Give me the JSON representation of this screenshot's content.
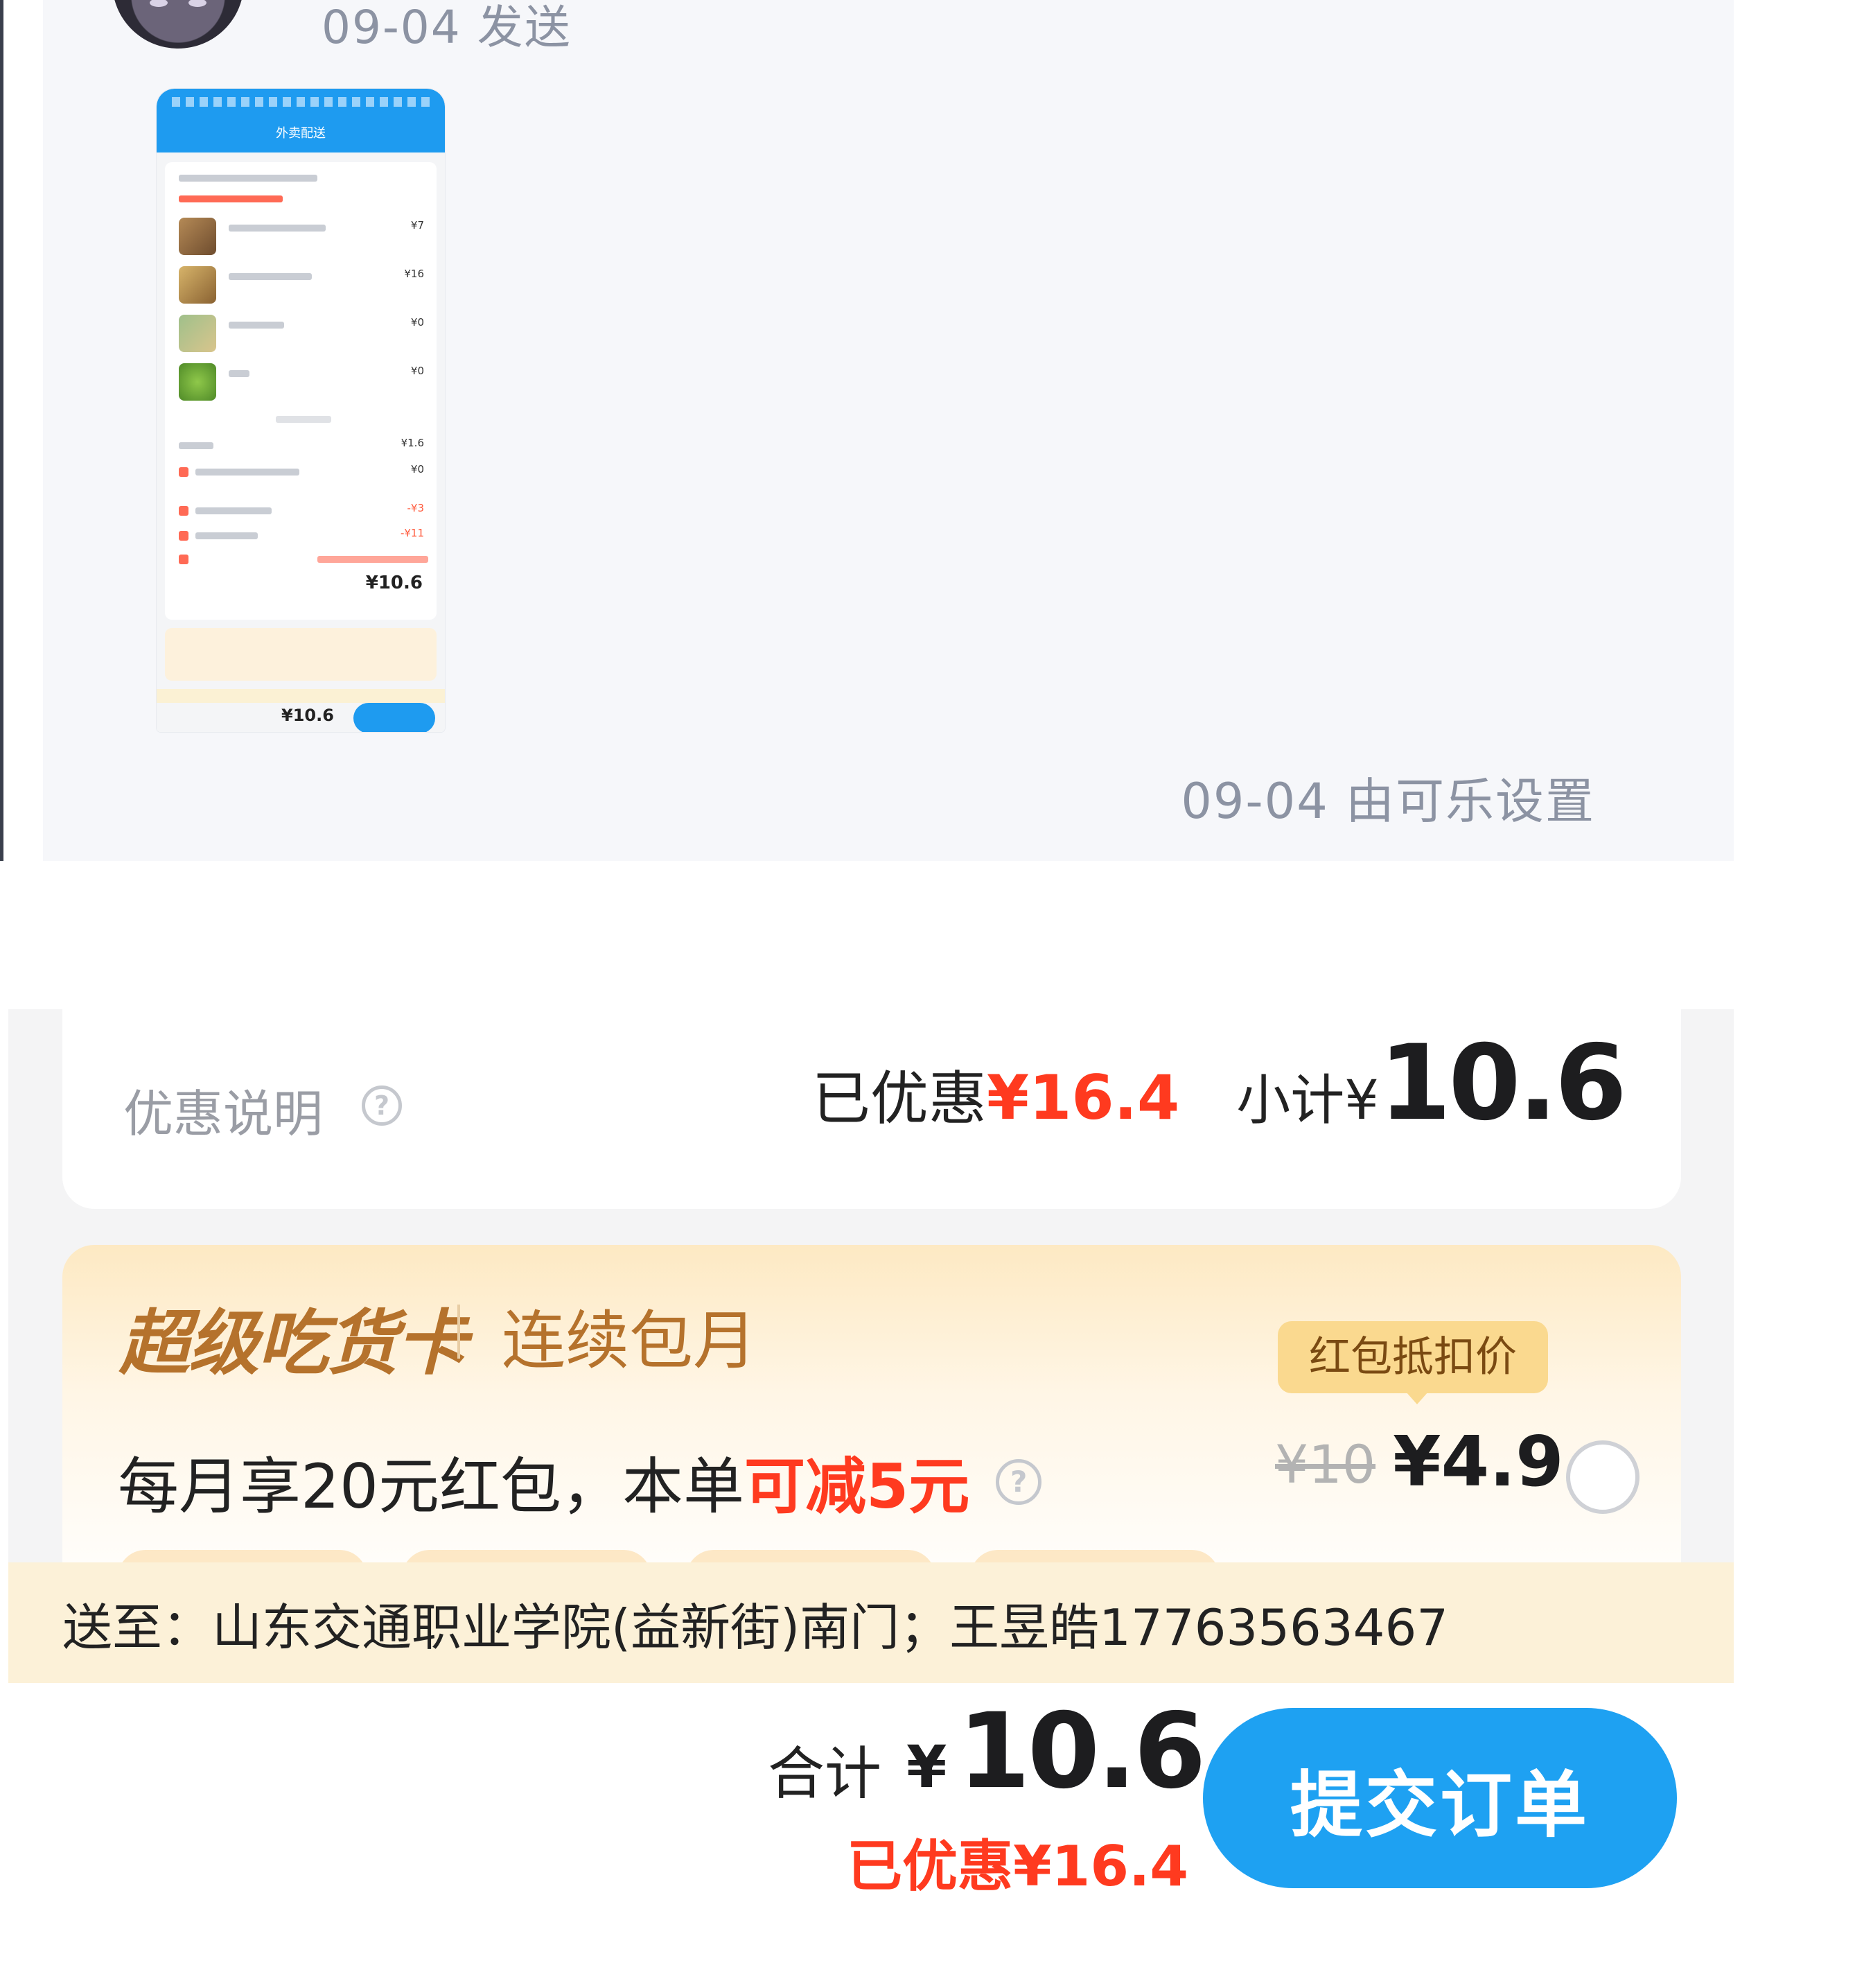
{
  "chat": {
    "sent_time": "09-04 发送",
    "set_time": "09-04 由可乐设置",
    "thumbnail": {
      "title": "外卖配送",
      "prices": [
        "¥7",
        "¥16",
        "¥0",
        "¥0",
        "¥1.6",
        "¥0",
        "-¥3",
        "-¥11"
      ],
      "subtotal": "¥10.6",
      "total": "¥10.6"
    }
  },
  "order": {
    "discount_label": "优惠说明",
    "saved_label": "已优惠",
    "saved_amount": "¥16.4",
    "subtotal_label": "小计¥",
    "subtotal_amount": "10.6",
    "vip": {
      "title": "超级吃货卡",
      "subtitle": "连续包月",
      "desc_prefix": "每月享20元红包，本单",
      "desc_highlight": "可减5元",
      "badge": "红包抵扣价",
      "old_price": "¥10",
      "new_price": "¥4.9"
    },
    "address": "送至：山东交通职业学院(益新街)南门；王昱皓17763563467",
    "total_label": "合计",
    "total_currency": "¥",
    "total_amount": "10.6",
    "total_saved": "已优惠¥16.4",
    "submit_label": "提交订单"
  },
  "colors": {
    "accent_blue": "#1ea1f2",
    "discount_red": "#ff3a1f",
    "vip_brown": "#b5722c",
    "address_bg": "#fcf1d8"
  },
  "icons": [
    "help-icon",
    "radio-icon",
    "avatar"
  ]
}
